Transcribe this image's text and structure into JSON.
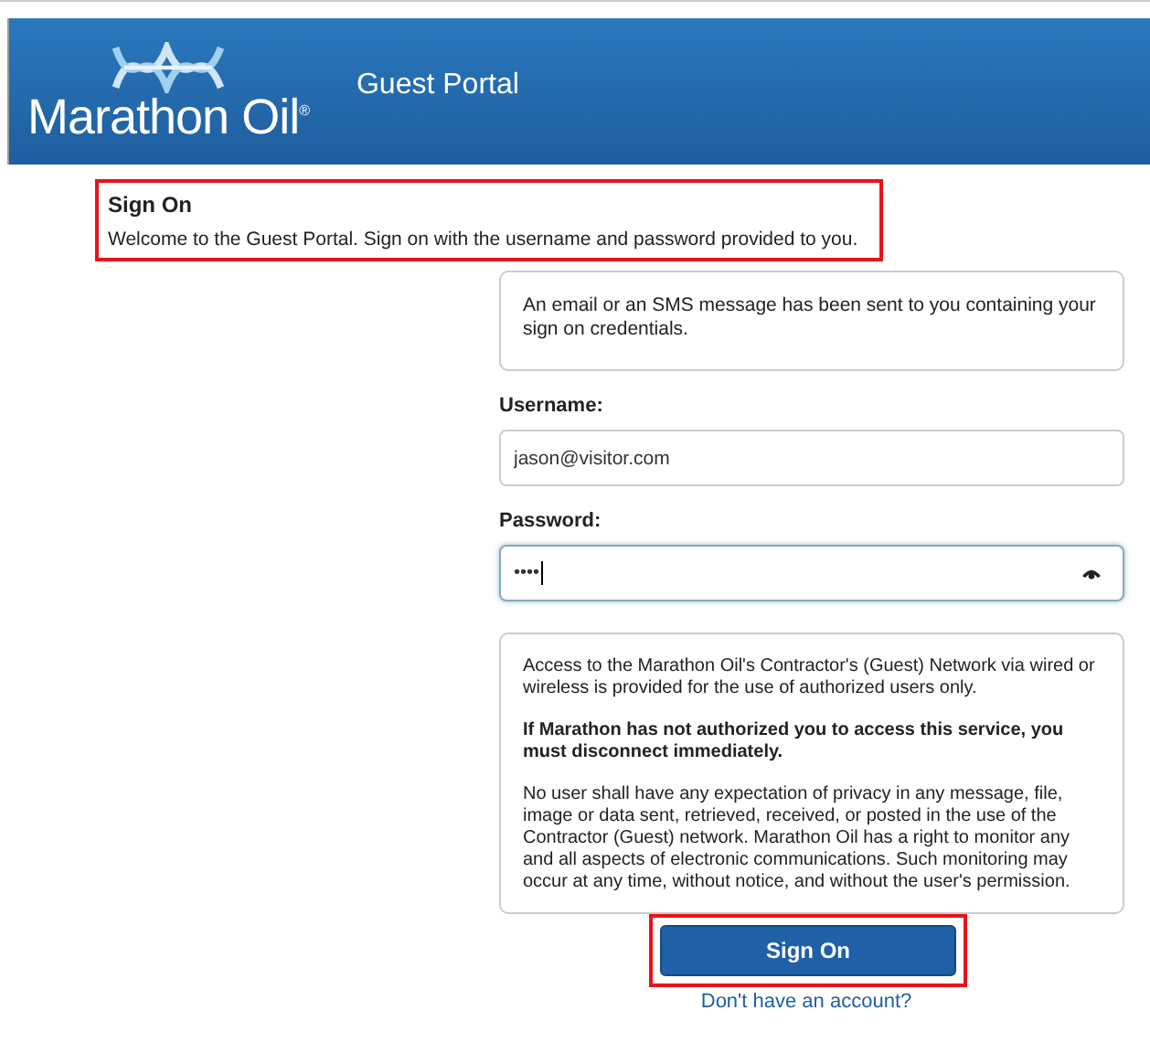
{
  "header": {
    "logo_text": "Marathon Oil",
    "logo_mark": "®",
    "title": "Guest Portal"
  },
  "intro": {
    "heading": "Sign On",
    "text": "Welcome to the Guest Portal. Sign on with the username and password provided to you.",
    "highlighted": true
  },
  "notice": "An email or an SMS message has been sent to you containing your sign on credentials.",
  "username": {
    "label": "Username:",
    "value": "jason@visitor.com"
  },
  "password": {
    "label": "Password:",
    "value": "••••",
    "focused": true
  },
  "disclaimer": {
    "paragraphs": [
      {
        "text": "Access to the Marathon Oil's Contractor's (Guest) Network via wired or wireless is provided for the use of authorized users only.",
        "bold": false
      },
      {
        "text": "If Marathon has not authorized you to access this service, you must disconnect immediately.",
        "bold": true
      },
      {
        "text": "No user shall have any expectation of privacy in any message, file, image or data sent, retrieved, received, or posted in the use of the Contractor (Guest) network. Marathon Oil has a right to monitor any and all aspects of electronic communications. Such monitoring may occur at any time, without notice, and without the user's permission.",
        "bold": false
      }
    ]
  },
  "sign_on_button": {
    "label": "Sign On",
    "highlighted": true
  },
  "account_link": "Don't have an account?"
}
